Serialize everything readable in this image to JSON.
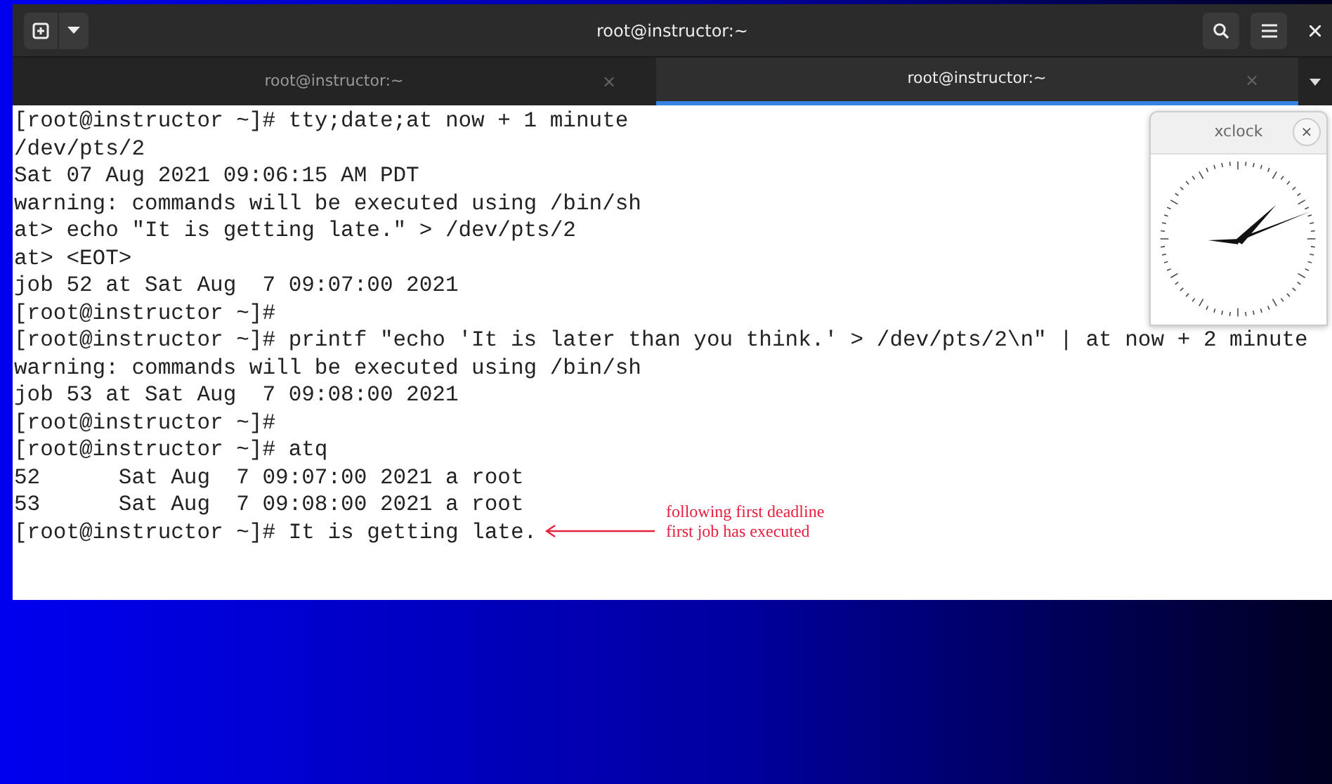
{
  "window": {
    "title": "root@instructor:~"
  },
  "tabs": [
    {
      "label": "root@instructor:~",
      "selected": false,
      "close": "×"
    },
    {
      "label": "root@instructor:~",
      "selected": true,
      "close": "×"
    }
  ],
  "terminal": {
    "lines": [
      "[root@instructor ~]# tty;date;at now + 1 minute",
      "/dev/pts/2",
      "Sat 07 Aug 2021 09:06:15 AM PDT",
      "warning: commands will be executed using /bin/sh",
      "at> echo \"It is getting late.\" > /dev/pts/2",
      "at> <EOT>",
      "job 52 at Sat Aug  7 09:07:00 2021",
      "[root@instructor ~]#",
      "[root@instructor ~]# printf \"echo 'It is later than you think.' > /dev/pts/2\\n\" | at now + 2 minute",
      "warning: commands will be executed using /bin/sh",
      "job 53 at Sat Aug  7 09:08:00 2021",
      "[root@instructor ~]#",
      "[root@instructor ~]# atq",
      "52      Sat Aug  7 09:07:00 2021 a root",
      "53      Sat Aug  7 09:08:00 2021 a root",
      "[root@instructor ~]# It is getting late."
    ]
  },
  "clock": {
    "title": "xclock",
    "close": "×"
  },
  "annotation": {
    "lines": [
      "following first deadline",
      "first job has executed"
    ]
  }
}
